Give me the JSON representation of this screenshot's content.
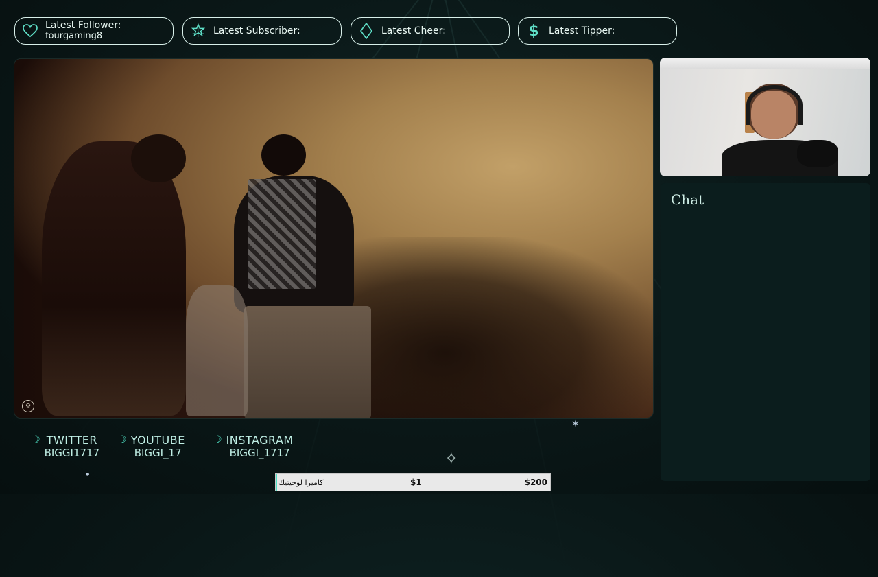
{
  "alerts": [
    {
      "label": "Latest Follower:",
      "value": "fourgaming8",
      "icon": "heart-icon"
    },
    {
      "label": "Latest Subscriber:",
      "value": "",
      "icon": "star-icon"
    },
    {
      "label": "Latest Cheer:",
      "value": "",
      "icon": "diamond-icon"
    },
    {
      "label": "Latest Tipper:",
      "value": "",
      "icon": "dollar-icon"
    }
  ],
  "chat": {
    "title": "Chat"
  },
  "socials": [
    {
      "name": "TWITTER",
      "handle": "BIGGI1717"
    },
    {
      "name": "YOUTUBE",
      "handle": "BIGGI_17"
    },
    {
      "name": "INSTAGRAM",
      "handle": "BIGGI_1717"
    }
  ],
  "donation_goal": {
    "label": "كاميرا لوجيتيك",
    "current": "$1",
    "goal": "$200",
    "progress_fraction": 0.005
  },
  "colors": {
    "accent": "#4fe0c4",
    "background": "#0a1717",
    "panel": "#0b1d1d"
  }
}
